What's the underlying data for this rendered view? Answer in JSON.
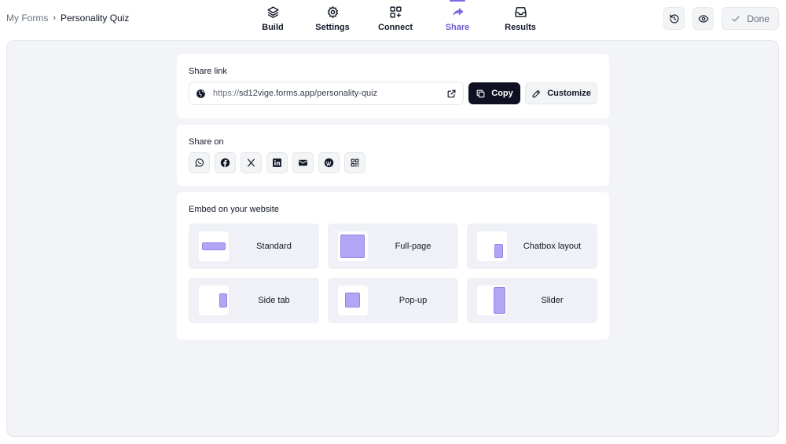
{
  "breadcrumb": {
    "root": "My Forms",
    "separator": "›",
    "current": "Personality Quiz"
  },
  "tabs": [
    {
      "label": "Build",
      "icon": "layers-icon",
      "active": false
    },
    {
      "label": "Settings",
      "icon": "gear-icon",
      "active": false
    },
    {
      "label": "Connect",
      "icon": "grid-plus-icon",
      "active": false
    },
    {
      "label": "Share",
      "icon": "share-arrow-icon",
      "active": true
    },
    {
      "label": "Results",
      "icon": "inbox-icon",
      "active": false
    }
  ],
  "top_actions": {
    "done_label": "Done"
  },
  "share_link": {
    "title": "Share link",
    "url_protocol": "https://",
    "url_rest": "sd12vige.forms.app/personality-quiz",
    "copy_label": "Copy",
    "customize_label": "Customize"
  },
  "share_on": {
    "title": "Share on",
    "platforms": [
      "whatsapp-icon",
      "facebook-icon",
      "x-icon",
      "linkedin-icon",
      "email-icon",
      "wordpress-icon",
      "qr-code-icon"
    ]
  },
  "embed": {
    "title": "Embed on your website",
    "options": [
      {
        "label": "Standard"
      },
      {
        "label": "Full-page"
      },
      {
        "label": "Chatbox layout"
      },
      {
        "label": "Side tab"
      },
      {
        "label": "Pop-up"
      },
      {
        "label": "Slider"
      }
    ]
  },
  "colors": {
    "accent": "#6d5bd0",
    "copy_button": "#0f1021",
    "thumb_fill": "#b3a5f5",
    "canvas": "#f3f4f8"
  }
}
